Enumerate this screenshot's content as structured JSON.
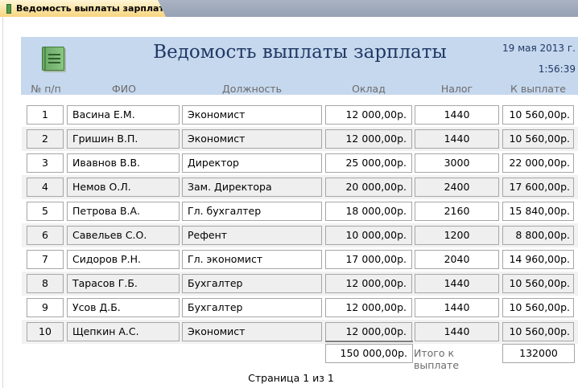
{
  "tab": {
    "label": "Ведомость выплаты зарплаты"
  },
  "header": {
    "title": "Ведомость выплаты зарплаты",
    "date": "19 мая 2013 г.",
    "time": "1:56:39",
    "icon": "report-book-icon"
  },
  "columns": [
    "№ п/п",
    "ФИО",
    "Должность",
    "Оклад",
    "Налог",
    "К выплате"
  ],
  "rows": [
    {
      "num": "1",
      "fio": "Васина Е.М.",
      "position": "Экономист",
      "salary": "12 000,00р.",
      "tax": "1440",
      "pay": "10 560,00р."
    },
    {
      "num": "2",
      "fio": "Гришин В.П.",
      "position": "Экономист",
      "salary": "12 000,00р.",
      "tax": "1440",
      "pay": "10 560,00р."
    },
    {
      "num": "3",
      "fio": "Ивавнов В.В.",
      "position": "Директор",
      "salary": "25 000,00р.",
      "tax": "3000",
      "pay": "22 000,00р."
    },
    {
      "num": "4",
      "fio": "Немов О.Л.",
      "position": "Зам. Директора",
      "salary": "20 000,00р.",
      "tax": "2400",
      "pay": "17 600,00р."
    },
    {
      "num": "5",
      "fio": "Петрова В.А.",
      "position": "Гл. бухгалтер",
      "salary": "18 000,00р.",
      "tax": "2160",
      "pay": "15 840,00р."
    },
    {
      "num": "6",
      "fio": "Савельев С.О.",
      "position": "Рефент",
      "salary": "10 000,00р.",
      "tax": "1200",
      "pay": "8 800,00р."
    },
    {
      "num": "7",
      "fio": "Сидоров Р.Н.",
      "position": "Гл. экономист",
      "salary": "17 000,00р.",
      "tax": "2040",
      "pay": "14 960,00р."
    },
    {
      "num": "8",
      "fio": "Тарасов Г.Б.",
      "position": "Бухгалтер",
      "salary": "12 000,00р.",
      "tax": "1440",
      "pay": "10 560,00р."
    },
    {
      "num": "9",
      "fio": "Усов Д.Б.",
      "position": "Бухгалтер",
      "salary": "12 000,00р.",
      "tax": "1440",
      "pay": "10 560,00р."
    },
    {
      "num": "10",
      "fio": "Щепкин А.С.",
      "position": "Экономист",
      "salary": "12 000,00р.",
      "tax": "1440",
      "pay": "10 560,00р."
    }
  ],
  "totals": {
    "salary_sum": "150 000,00р.",
    "pay_label": "Итого к выплате",
    "pay_sum": "132000"
  },
  "footer": {
    "page": "Страница 1 из 1"
  },
  "colors": {
    "header_band": "#c6d8ee",
    "title": "#1f3864",
    "tab": "#f7d57f"
  }
}
